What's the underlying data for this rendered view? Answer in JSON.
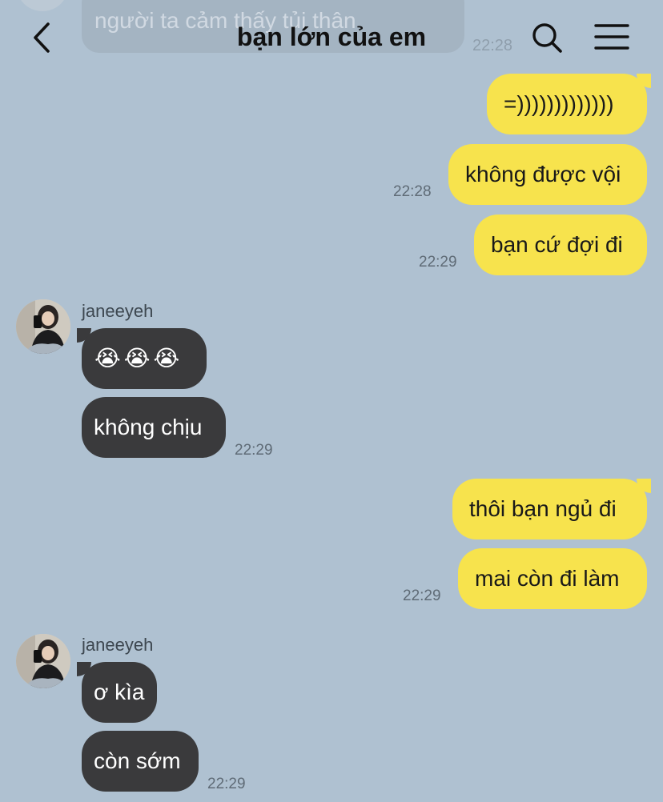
{
  "header": {
    "title": "bạn lớn của em",
    "back_icon": "chevron-left-icon",
    "search_icon": "search-icon",
    "menu_icon": "hamburger-menu-icon"
  },
  "previous_message": {
    "text": "người ta cảm thấy tủi thân",
    "time": "22:28"
  },
  "colors": {
    "background": "#afc1d1",
    "outgoing_bubble": "#f7e34d",
    "incoming_bubble": "#3a3a3c"
  },
  "messages": {
    "m1": {
      "direction": "outgoing",
      "text": "=)))))))))))))"
    },
    "m2": {
      "direction": "outgoing",
      "text": "không được vội",
      "time": "22:28"
    },
    "m3": {
      "direction": "outgoing",
      "text": "bạn cứ đợi đi",
      "time": "22:29"
    },
    "g1": {
      "sender": "janeeyeh",
      "m4": {
        "direction": "incoming",
        "emoji": [
          "😭",
          "😭",
          "😭"
        ],
        "emoji_name": "loudly-crying-face-icon"
      },
      "m5": {
        "direction": "incoming",
        "text": "không chịu",
        "time": "22:29"
      }
    },
    "m6": {
      "direction": "outgoing",
      "text": "thôi bạn ngủ đi"
    },
    "m7": {
      "direction": "outgoing",
      "text": "mai còn đi làm",
      "time": "22:29"
    },
    "g2": {
      "sender": "janeeyeh",
      "m8": {
        "direction": "incoming",
        "text": "ơ kìa"
      },
      "m9": {
        "direction": "incoming",
        "text": "còn sớm",
        "time": "22:29"
      }
    }
  }
}
